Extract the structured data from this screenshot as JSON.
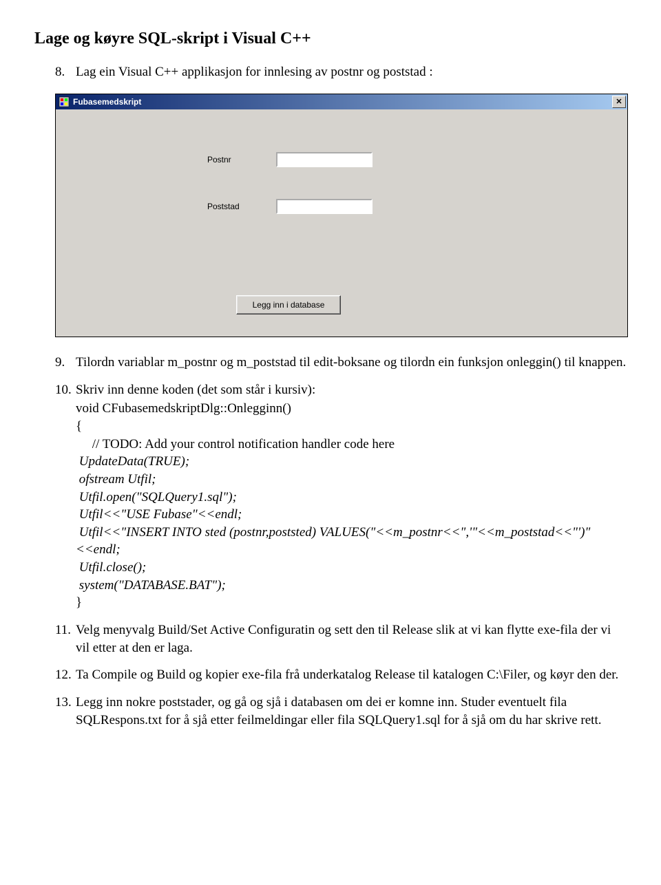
{
  "heading": "Lage og køyre SQL-skript i Visual C++",
  "item8": {
    "num": "8.",
    "text": "Lag ein Visual C++ applikasjon for innlesing av postnr og poststad :"
  },
  "dialog": {
    "title": "Fubasemedskript",
    "close": "✕",
    "label_postnr": "Postnr",
    "label_poststad": "Poststad",
    "button_label": "Legg inn i database"
  },
  "item9": {
    "num": "9.",
    "text": "Tilordn variablar m_postnr og m_poststad til edit-boksane og tilordn ein funksjon onleggin() til knappen."
  },
  "item10": {
    "num": "10.",
    "intro": "Skriv inn denne koden (det som står i kursiv):",
    "line1": "void CFubasemedskriptDlg::Onlegginn()",
    "line2": "{",
    "line3": "     // TODO: Add your control notification handler code here",
    "line4": " UpdateData(TRUE);",
    "line5": " ofstream Utfil;",
    "line6": " Utfil.open(\"SQLQuery1.sql\");",
    "line7": " Utfil<<\"USE Fubase\"<<endl;",
    "line8": " Utfil<<\"INSERT INTO sted (postnr,poststed) VALUES(\"<<m_postnr<<\",'\"<<m_poststad<<\"')\"<<endl;",
    "line9": " Utfil.close();",
    "line10": " system(\"DATABASE.BAT\");",
    "line11": "}"
  },
  "item11": {
    "num": "11.",
    "text": "Velg menyvalg Build/Set Active Configuratin  og sett den til Release slik at vi kan flytte exe-fila der vi vil etter at den er laga."
  },
  "item12": {
    "num": "12.",
    "text": "Ta Compile og Build og kopier exe-fila  frå  underkatalog Release til katalogen C:\\Filer, og køyr den der."
  },
  "item13": {
    "num": "13.",
    "text": "Legg inn nokre poststader, og gå og sjå i databasen om dei er komne inn. Studer eventuelt fila SQLRespons.txt for å sjå etter feilmeldingar eller fila SQLQuery1.sql for å sjå om du har skrive rett."
  }
}
